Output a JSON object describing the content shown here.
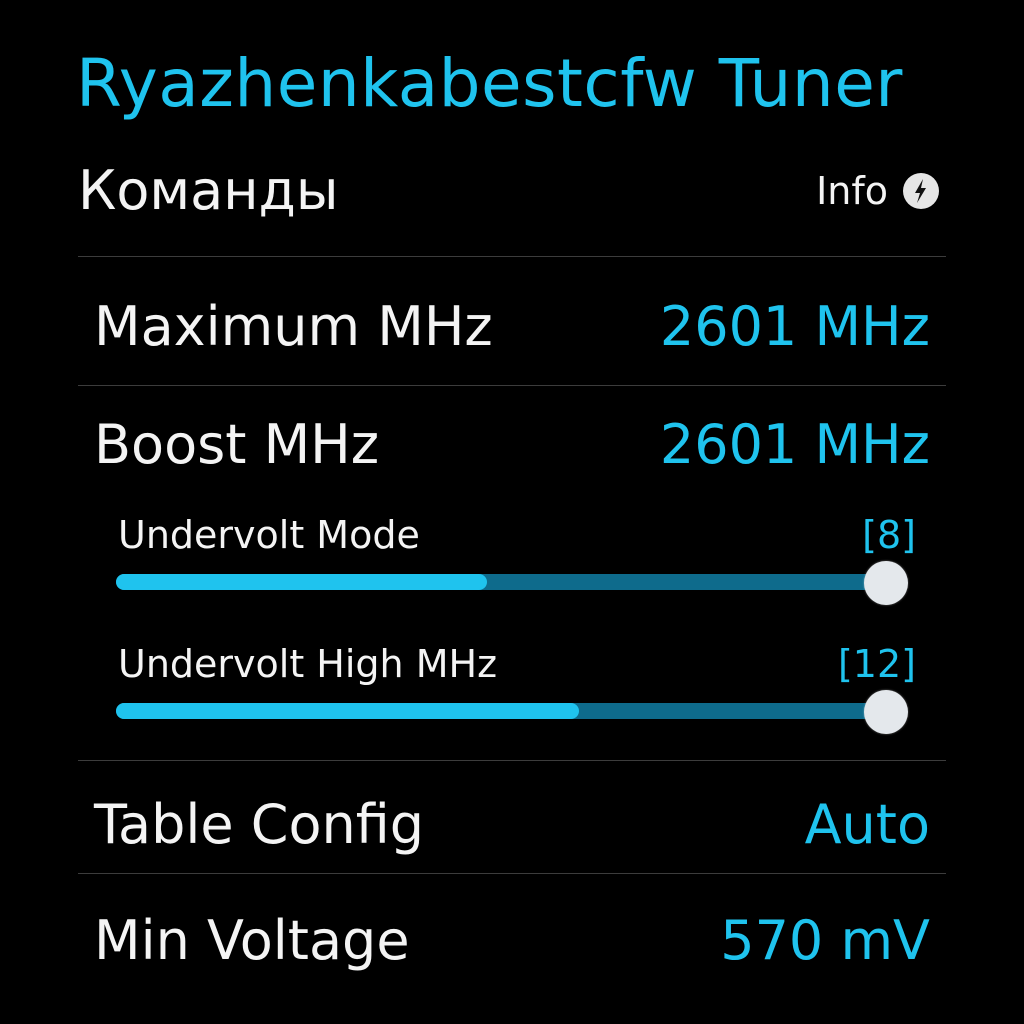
{
  "app": {
    "title": "Ryazhenkabestcfw Tuner"
  },
  "section": {
    "title": "Команды",
    "info_label": "Info",
    "info_icon": "lightning-icon"
  },
  "settings": {
    "maximum_mhz": {
      "label": "Maximum MHz",
      "value": "2601 MHz"
    },
    "boost_mhz": {
      "label": "Boost MHz",
      "value": "2601 MHz"
    },
    "undervolt_mode": {
      "label": "Undervolt Mode",
      "value": "[8]",
      "fill_percent": 48
    },
    "undervolt_high_mhz": {
      "label": "Undervolt High MHz",
      "value": "[12]",
      "fill_percent": 60
    },
    "table_config": {
      "label": "Table Config",
      "value": "Auto"
    },
    "min_voltage": {
      "label": "Min Voltage",
      "value": "570 mV"
    }
  },
  "colors": {
    "accent": "#1fc3ee",
    "track": "#0e6b8c",
    "text": "#f4f4f4",
    "background": "#000000",
    "thumb": "#e4e8ec"
  }
}
